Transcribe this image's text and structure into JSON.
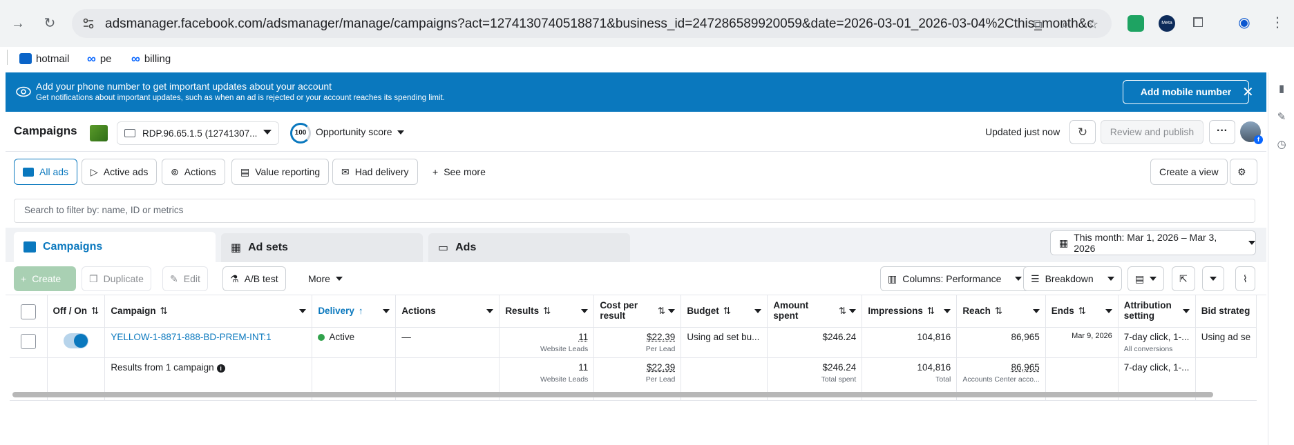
{
  "browser": {
    "url": "adsmanager.facebook.com/adsmanager/manage/campaigns?act=1274130740518871&business_id=247286589920059&date=2026-03-01_2026-03-04%2Cthis_month&c...",
    "bookmarks": [
      "hotmail",
      "pe",
      "billing"
    ],
    "extension_label": "Meta"
  },
  "banner": {
    "title": "Add your phone number to get important updates about your account",
    "subtitle": "Get notifications about important updates, such as when an ad is rejected or your account reaches its spending limit.",
    "button": "Add mobile number"
  },
  "header": {
    "title": "Campaigns",
    "account": "RDP.96.65.1.5 (12741307...",
    "score": "100",
    "score_label": "Opportunity score",
    "updated": "Updated just now",
    "review_publish": "Review and publish"
  },
  "filters": {
    "pills": [
      "All ads",
      "Active ads",
      "Actions",
      "Value reporting",
      "Had delivery"
    ],
    "see_more": "See more",
    "create_view": "Create a view",
    "search_placeholder": "Search to filter by: name, ID or metrics"
  },
  "tabs": [
    "Campaigns",
    "Ad sets",
    "Ads"
  ],
  "date_range": "This month: Mar 1, 2026 – Mar 3, 2026",
  "toolbar": {
    "create": "Create",
    "duplicate": "Duplicate",
    "edit": "Edit",
    "ab_test": "A/B test",
    "more": "More",
    "columns": "Columns: Performance",
    "breakdown": "Breakdown"
  },
  "table": {
    "headers": {
      "off_on": "Off / On",
      "campaign": "Campaign",
      "delivery": "Delivery",
      "actions": "Actions",
      "results": "Results",
      "cost_per_result": "Cost per result",
      "budget": "Budget",
      "amount_spent": "Amount spent",
      "impressions": "Impressions",
      "reach": "Reach",
      "ends": "Ends",
      "attribution": "Attribution setting",
      "bid_strategy": "Bid strateg"
    },
    "row": {
      "campaign": "YELLOW-1-8871-888-BD-PREM-INT:1",
      "delivery": "Active",
      "actions": "—",
      "results": "11",
      "results_sub": "Website Leads",
      "cost": "$22.39",
      "cost_sub": "Per Lead",
      "budget": "Using ad set bu...",
      "spent": "$246.24",
      "impressions": "104,816",
      "reach": "86,965",
      "ends": "Mar 9, 2026",
      "attribution": "7-day click, 1-...",
      "attribution_sub": "All conversions",
      "bid": "Using ad se"
    },
    "summary": {
      "label": "Results from 1 campaign",
      "results": "11",
      "results_sub": "Website Leads",
      "cost": "$22.39",
      "cost_sub": "Per Lead",
      "spent": "$246.24",
      "spent_sub": "Total spent",
      "impressions": "104,816",
      "impressions_sub": "Total",
      "reach": "86,965",
      "reach_sub": "Accounts Center acco...",
      "attribution": "7-day click, 1-..."
    }
  }
}
